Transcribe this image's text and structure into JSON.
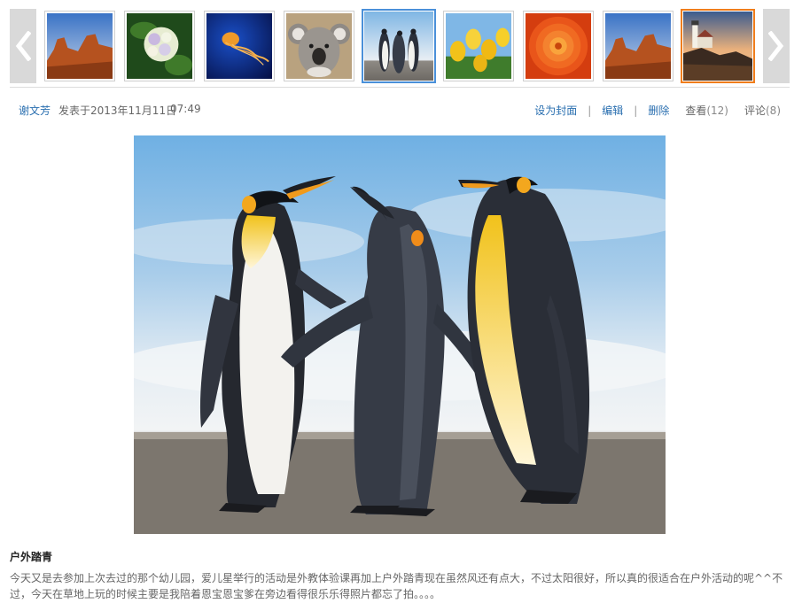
{
  "gallery": {
    "prev_icon": "chevron-left-icon",
    "next_icon": "chevron-right-icon",
    "thumbnails": [
      {
        "subject": "desert-mesa"
      },
      {
        "subject": "hydrangea"
      },
      {
        "subject": "jellyfish"
      },
      {
        "subject": "koala"
      },
      {
        "subject": "penguins"
      },
      {
        "subject": "tulips"
      },
      {
        "subject": "chrysanthemum"
      },
      {
        "subject": "desert-mesa"
      },
      {
        "subject": "lighthouse"
      }
    ],
    "selected_index": 4,
    "hover_index": 8,
    "colors": {
      "selected_border": "#4a90d9",
      "current_border": "#f07d1b"
    }
  },
  "post": {
    "author": "谢文芳",
    "posted_prefix": "发表于",
    "posted_date": "2013年11月11日",
    "posted_time": "07:49",
    "actions": {
      "set_cover": "设为封面",
      "edit": "编辑",
      "delete": "删除",
      "separator": "|"
    },
    "views_label": "查看",
    "views_count": "(12)",
    "comments_label": "评论",
    "comments_count": "(8)"
  },
  "photo": {
    "subject": "penguins"
  },
  "caption": {
    "title": "户外踏青",
    "text": "今天又是去参加上次去过的那个幼儿园，爱儿星举行的活动是外教体验课再加上户外踏青现在虽然风还有点大，不过太阳很好，所以真的很适合在户外活动的呢^^不过，今天在草地上玩的时候主要是我陪着恩宝恩宝爹在旁边看得很乐乐得照片都忘了拍。。。。"
  },
  "theme": {
    "link": "#2a6fb0",
    "muted": "#666666"
  }
}
